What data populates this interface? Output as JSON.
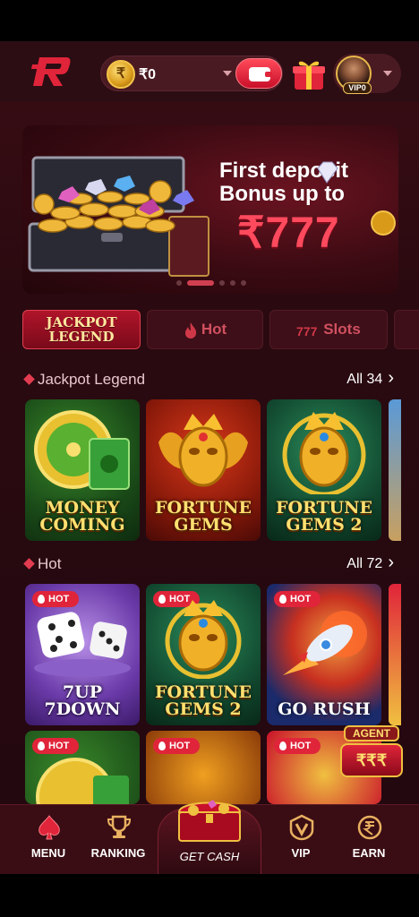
{
  "header": {
    "balance": "₹0",
    "coin_symbol": "₹",
    "vip_badge": "VIP0"
  },
  "banner": {
    "title_line1": "First deposit",
    "title_line2": "Bonus up to",
    "amount": "₹777"
  },
  "tabs": [
    {
      "label_line1": "JACKPOT",
      "label_line2": "LEGEND",
      "active": true
    },
    {
      "label": "Hot",
      "icon": "flame-icon"
    },
    {
      "label": "Slots",
      "icon": "777-icon"
    }
  ],
  "sections": [
    {
      "title": "Jackpot Legend",
      "all": "All 34",
      "games": [
        {
          "line1": "MONEY",
          "line2": "COMING"
        },
        {
          "line1": "FORTUNE",
          "line2": "GEMS"
        },
        {
          "line1": "FORTUNE",
          "line2": "GEMS 2"
        }
      ]
    },
    {
      "title": "Hot",
      "all": "All 72",
      "badge": "HOT",
      "games": [
        {
          "line1": "7UP",
          "line2": "7DOWN"
        },
        {
          "line1": "FORTUNE",
          "line2": "GEMS 2"
        },
        {
          "line1": "",
          "line2": "GO RUSH"
        }
      ]
    }
  ],
  "agent_badge": "AGENT",
  "agent_amount": "₹₹₹",
  "bottom_nav": {
    "menu": "MENU",
    "ranking": "RANKING",
    "get_cash": "GET CASH",
    "vip": "VIP",
    "earn": "EARN"
  },
  "colors": {
    "accent": "#e0243a",
    "background": "#2a0a10",
    "gold": "#ffe070"
  }
}
